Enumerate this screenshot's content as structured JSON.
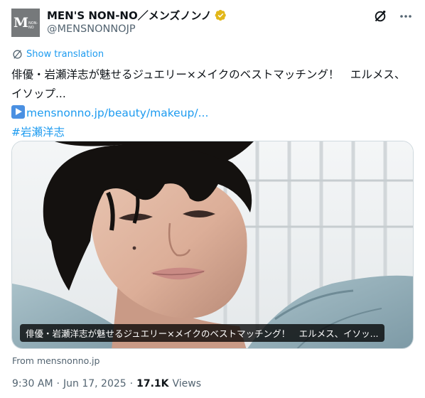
{
  "account": {
    "avatar_mark": "M",
    "avatar_small": "NON-NO",
    "name": "MEN'S NON-NO／メンズノンノ",
    "handle": "@MENSNONNOJP"
  },
  "icons": {
    "verified": "gold-verified-badge-icon",
    "grok": "grok-icon",
    "more": "more-dots-icon",
    "translate": "translate-globe-icon",
    "link_emoji": "play-arrow-emoji-icon"
  },
  "translate_label": "Show translation",
  "tweet": {
    "text": "俳優・岩瀬洋志が魅せるジュエリー×メイクのベストマッチング！　エルメス、イソップ...",
    "link": "mensnonno.jp/beauty/makeup/...",
    "hashtag": "#岩瀬洋志"
  },
  "media": {
    "caption": "俳優・岩瀬洋志が魅せるジュエリー×メイクのベストマッチング！　エルメス、イソッ...",
    "source": "From mensnonno.jp"
  },
  "meta": {
    "time": "9:30 AM",
    "date": "Jun 17, 2025",
    "separator": "·",
    "views_count": "17.1K",
    "views_label": "Views"
  },
  "colors": {
    "link": "#1d9bf0",
    "secondary_text": "#536471",
    "verified_gold": "#e2b719",
    "avatar_bg": "#76797b"
  }
}
